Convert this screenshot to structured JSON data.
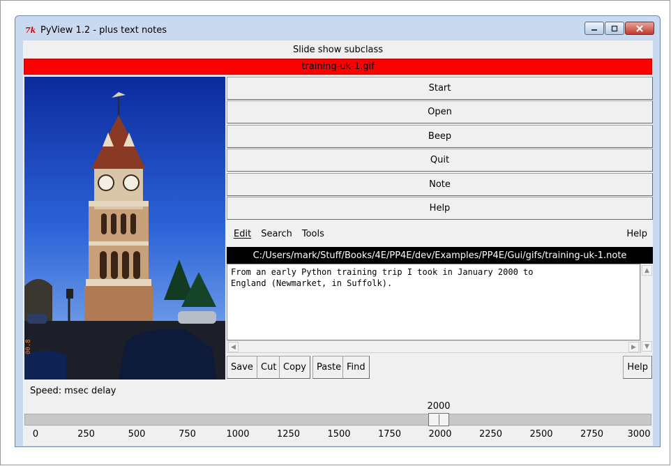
{
  "window": {
    "title": "PyView 1.2 - plus text notes",
    "logo_text": "7k"
  },
  "header": {
    "subclass_label": "Slide show subclass",
    "current_file": "training-uk-1.gif"
  },
  "buttons": [
    "Start",
    "Open",
    "Beep",
    "Quit",
    "Note",
    "Help"
  ],
  "editor": {
    "menus": [
      "Edit",
      "Search",
      "Tools"
    ],
    "menu_help": "Help",
    "note_path": "C:/Users/mark/Stuff/Books/4E/PP4E/dev/Examples/PP4E/Gui/gifs/training-uk-1.note",
    "note_text": "From an early Python training trip I took in January 2000 to\nEngland (Newmarket, in Suffolk).",
    "toolbar": [
      "Save",
      "Cut",
      "Copy",
      "Paste",
      "Find"
    ],
    "toolbar_help": "Help"
  },
  "speed": {
    "label": "Speed: msec delay",
    "value": "2000",
    "ticks": [
      "0",
      "250",
      "500",
      "750",
      "1000",
      "1250",
      "1500",
      "1750",
      "2000",
      "2250",
      "2500",
      "2750",
      "3000"
    ]
  },
  "colors": {
    "filebar": "#ff0000",
    "pathbar": "#000000"
  }
}
